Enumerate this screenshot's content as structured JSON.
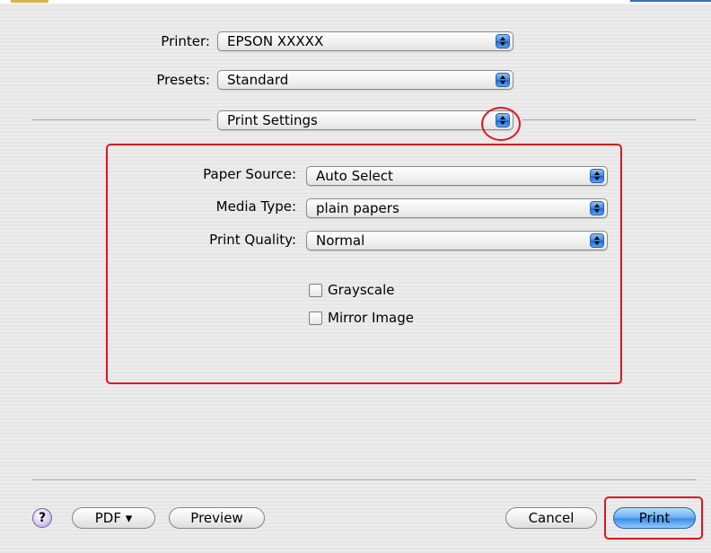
{
  "printer": {
    "label": "Printer:",
    "value": "EPSON XXXXX"
  },
  "presets": {
    "label": "Presets:",
    "value": "Standard"
  },
  "panel_selector": {
    "value": "Print Settings"
  },
  "settings": {
    "paper_source": {
      "label": "Paper Source:",
      "value": "Auto Select"
    },
    "media_type": {
      "label": "Media Type:",
      "value": "plain papers"
    },
    "print_quality": {
      "label": "Print Quality:",
      "value": "Normal"
    },
    "grayscale": {
      "label": "Grayscale",
      "checked": false
    },
    "mirror_image": {
      "label": "Mirror Image",
      "checked": false
    }
  },
  "footer": {
    "help": "?",
    "pdf": "PDF ▾",
    "preview": "Preview",
    "cancel": "Cancel",
    "print": "Print"
  },
  "colors": {
    "highlight": "#e0151f",
    "accent": "#3b86e0"
  }
}
